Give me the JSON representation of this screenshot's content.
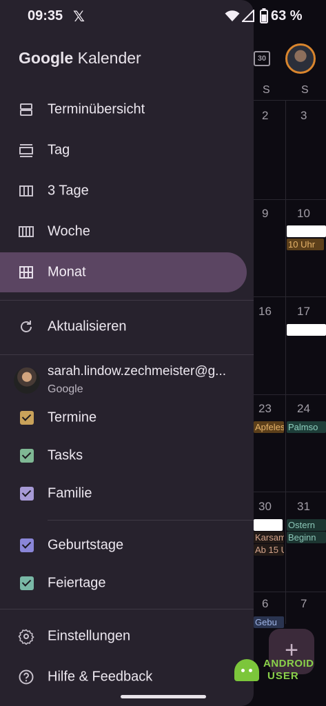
{
  "status_bar": {
    "time": "09:35",
    "x_logo": "𝕏",
    "battery": "63 %"
  },
  "calendar_bg": {
    "today_icon": "30",
    "weekday_headers": [
      "S",
      "S"
    ],
    "day_numbers": [
      [
        "2",
        "3"
      ],
      [
        "9",
        "10"
      ],
      [
        "16",
        "17"
      ],
      [
        "23",
        "24"
      ],
      [
        "30",
        "31"
      ],
      [
        "6",
        "7"
      ]
    ],
    "events": {
      "e10_uhr": "10 Uhr",
      "e_apfeles": "Apfeles",
      "e_palmso": "Palmso",
      "e_ostern": "Ostern",
      "e_beginn": "Beginn",
      "e_karsam": "Karsam",
      "e_ab15": "Ab 15 U",
      "e_gebu": "Gebu"
    },
    "fab_label": "+"
  },
  "drawer": {
    "title_brand": "Google",
    "title_app": "Kalender",
    "views": [
      {
        "label": "Terminübersicht",
        "icon": "schedule-view-icon"
      },
      {
        "label": "Tag",
        "icon": "day-view-icon"
      },
      {
        "label": "3 Tage",
        "icon": "three-day-view-icon"
      },
      {
        "label": "Woche",
        "icon": "week-view-icon"
      },
      {
        "label": "Monat",
        "icon": "month-view-icon",
        "selected": true
      }
    ],
    "refresh_label": "Aktualisieren",
    "account": {
      "email": "sarah.lindow.zechmeister@g...",
      "provider": "Google"
    },
    "calendars": [
      {
        "label": "Termine",
        "color": "#c9a25a",
        "checked": true
      },
      {
        "label": "Tasks",
        "color": "#7fb894",
        "checked": true
      },
      {
        "label": "Familie",
        "color": "#a79ad6",
        "checked": true
      },
      {
        "label": "Geburtstage",
        "color": "#8a86d8",
        "checked": true
      },
      {
        "label": "Feiertage",
        "color": "#79b8a6",
        "checked": true
      }
    ],
    "settings_label": "Einstellungen",
    "help_label": "Hilfe & Feedback"
  },
  "watermark": {
    "line1": "ANDROID",
    "line2": "USER"
  }
}
